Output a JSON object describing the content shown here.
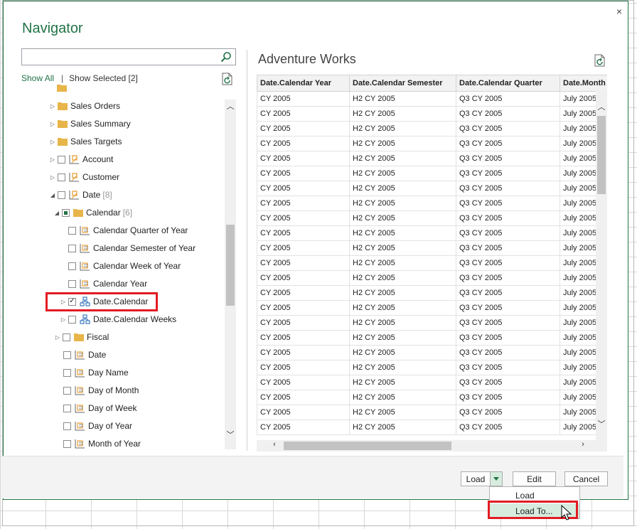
{
  "dialog": {
    "title": "Navigator",
    "close": "×"
  },
  "search": {
    "placeholder": ""
  },
  "filter": {
    "show_all": "Show All",
    "separator": "|",
    "show_selected": "Show Selected [2]"
  },
  "tree": {
    "items": [
      {
        "label": "Sales Orders",
        "icon": "folder-icon"
      },
      {
        "label": "Sales Summary",
        "icon": "folder-icon"
      },
      {
        "label": "Sales Targets",
        "icon": "folder-icon"
      },
      {
        "label": "Account",
        "icon": "dimension-icon",
        "checked": false
      },
      {
        "label": "Customer",
        "icon": "dimension-icon",
        "checked": false
      },
      {
        "label": "Date",
        "count": "[8]",
        "icon": "dimension-icon",
        "checked": false
      },
      {
        "label": "Calendar",
        "count": "[6]",
        "icon": "folder-icon",
        "checked": "partial"
      },
      {
        "label": "Calendar Quarter of Year",
        "icon": "attribute-icon",
        "checked": false
      },
      {
        "label": "Calendar Semester of Year",
        "icon": "attribute-icon",
        "checked": false
      },
      {
        "label": "Calendar Week of Year",
        "icon": "attribute-icon",
        "checked": false
      },
      {
        "label": "Calendar Year",
        "icon": "attribute-icon",
        "checked": false
      },
      {
        "label": "Date.Calendar",
        "icon": "hierarchy-icon",
        "checked": true,
        "check_mark": "✓"
      },
      {
        "label": "Date.Calendar Weeks",
        "icon": "hierarchy-icon",
        "checked": false
      },
      {
        "label": "Fiscal",
        "icon": "folder-icon",
        "checked": false
      },
      {
        "label": "Date",
        "icon": "attribute-icon",
        "checked": false
      },
      {
        "label": "Day Name",
        "icon": "attribute-icon",
        "checked": false
      },
      {
        "label": "Day of Month",
        "icon": "attribute-icon",
        "checked": false
      },
      {
        "label": "Day of Week",
        "icon": "attribute-icon",
        "checked": false
      },
      {
        "label": "Day of Year",
        "icon": "attribute-icon",
        "checked": false
      },
      {
        "label": "Month of Year",
        "icon": "attribute-icon",
        "checked": false
      }
    ]
  },
  "preview": {
    "title": "Adventure Works",
    "columns": [
      "Date.Calendar Year",
      "Date.Calendar Semester",
      "Date.Calendar Quarter",
      "Date.Month"
    ],
    "row_values": [
      "CY 2005",
      "H2 CY 2005",
      "Q3 CY 2005",
      "July 2005"
    ],
    "row_count": 23
  },
  "footer": {
    "load": "Load",
    "edit": "Edit",
    "cancel": "Cancel"
  },
  "load_menu": {
    "load": "Load",
    "load_to": "Load To..."
  },
  "colors": {
    "accent": "#217346",
    "highlight": "#e31b23"
  }
}
